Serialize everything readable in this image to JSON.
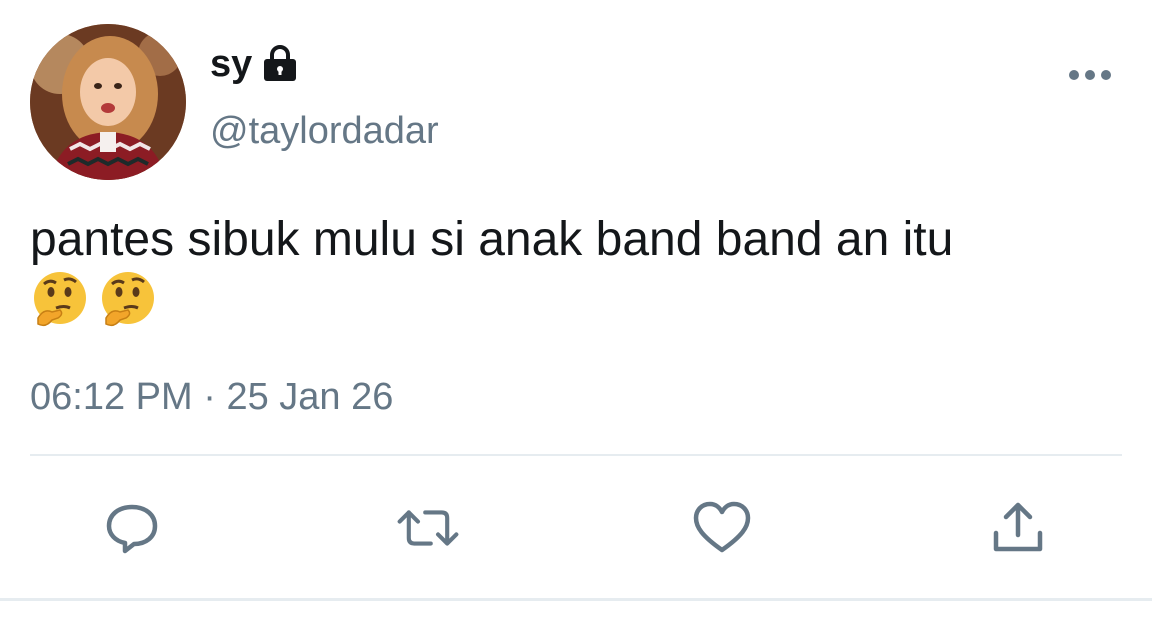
{
  "tweet": {
    "display_name": "sy",
    "handle": "@taylordadar",
    "text": "pantes sibuk mulu si anak band band an itu",
    "emojis": [
      "thinking-face",
      "thinking-face"
    ],
    "time": "06:12 PM",
    "separator": "·",
    "date": "25 Jan 26",
    "protected": true
  },
  "icons": {
    "lock": "lock-icon",
    "more": "more-horizontal-icon",
    "reply": "reply-icon",
    "retweet": "retweet-icon",
    "like": "like-icon",
    "share": "share-icon"
  },
  "colors": {
    "text_primary": "#14171a",
    "text_secondary": "#657786",
    "icon": "#657786",
    "divider": "#e6ecf0"
  }
}
